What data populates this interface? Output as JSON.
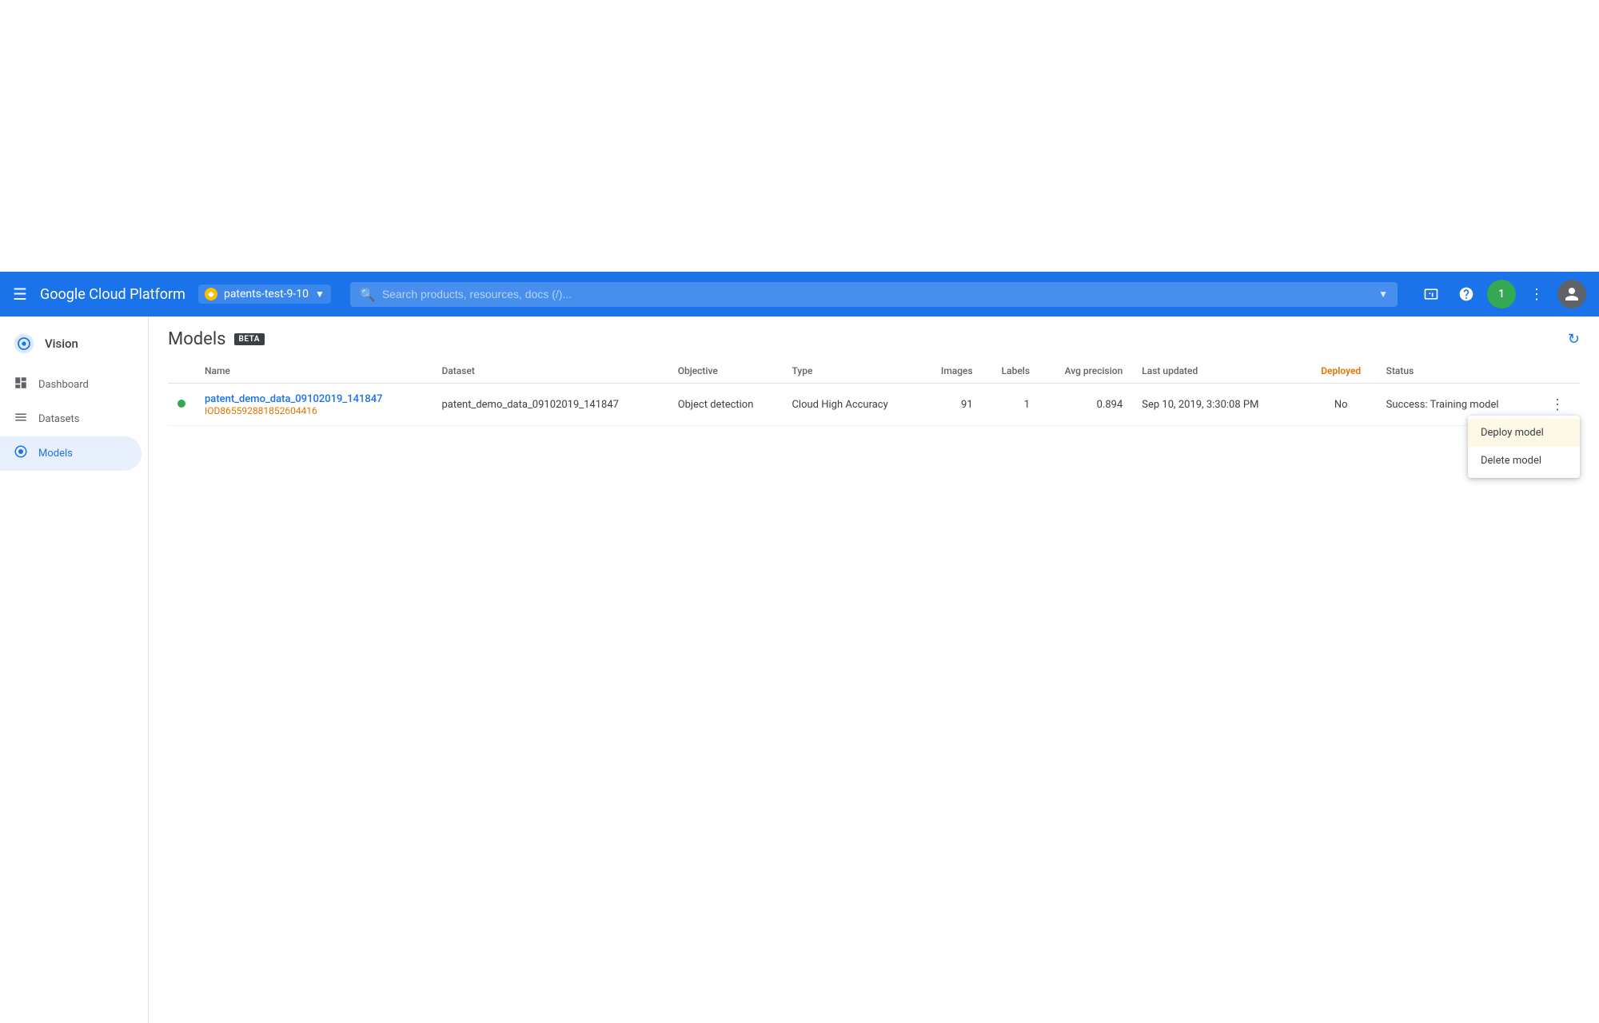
{
  "navbar": {
    "hamburger_label": "☰",
    "title": "Google Cloud Platform",
    "project": {
      "name": "patents-test-9-10",
      "icon": "◆"
    },
    "search_placeholder": "Search products, resources, docs (/)...",
    "icons": {
      "cloud": "☁",
      "help": "?",
      "notification_count": "1",
      "more": "⋮"
    }
  },
  "sidebar": {
    "logo_label": "Vision",
    "items": [
      {
        "id": "dashboard",
        "label": "Dashboard",
        "icon": "⊞",
        "active": false
      },
      {
        "id": "datasets",
        "label": "Datasets",
        "icon": "≡",
        "active": false
      },
      {
        "id": "models",
        "label": "Models",
        "icon": "◉",
        "active": true
      }
    ]
  },
  "page": {
    "title": "Models",
    "beta_label": "BETA",
    "table": {
      "columns": [
        {
          "id": "status_dot",
          "label": ""
        },
        {
          "id": "name",
          "label": "Name"
        },
        {
          "id": "dataset",
          "label": "Dataset"
        },
        {
          "id": "objective",
          "label": "Objective"
        },
        {
          "id": "type",
          "label": "Type"
        },
        {
          "id": "images",
          "label": "Images"
        },
        {
          "id": "labels",
          "label": "Labels"
        },
        {
          "id": "avg_precision",
          "label": "Avg precision"
        },
        {
          "id": "last_updated",
          "label": "Last updated"
        },
        {
          "id": "deployed",
          "label": "Deployed"
        },
        {
          "id": "status",
          "label": "Status"
        },
        {
          "id": "actions",
          "label": ""
        }
      ],
      "rows": [
        {
          "status": "green",
          "name": "patent_demo_data_09102019_141847",
          "model_id": "IOD865592881852604416",
          "dataset": "patent_demo_data_09102019_141847",
          "objective": "Object detection",
          "type": "Cloud High Accuracy",
          "images": "91",
          "labels": "1",
          "avg_precision": "0.894",
          "last_updated": "Sep 10, 2019, 3:30:08 PM",
          "deployed": "No",
          "status_text": "Success: Training model"
        }
      ]
    }
  },
  "context_menu": {
    "items": [
      {
        "id": "deploy",
        "label": "Deploy model",
        "highlighted": true
      },
      {
        "id": "delete",
        "label": "Delete model",
        "highlighted": false
      }
    ]
  }
}
